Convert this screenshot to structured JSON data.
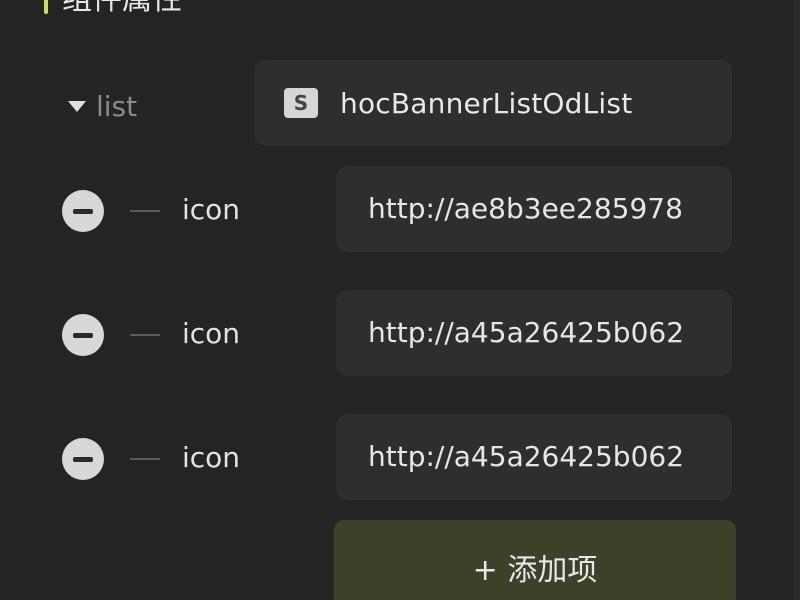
{
  "section": {
    "title": "组件属性"
  },
  "list": {
    "label": "list",
    "type_badge": "S",
    "value": "hocBannerListOdList"
  },
  "items": [
    {
      "label": "icon",
      "value": "http://ae8b3ee285978"
    },
    {
      "label": "icon",
      "value": "http://a45a26425b062"
    },
    {
      "label": "icon",
      "value": "http://a45a26425b062"
    }
  ],
  "add_button": {
    "label": "+ 添加项"
  },
  "colors": {
    "accent": "#c8e05a",
    "background": "#242424",
    "field": "#2e2e2e",
    "add_button": "#3c4128"
  }
}
